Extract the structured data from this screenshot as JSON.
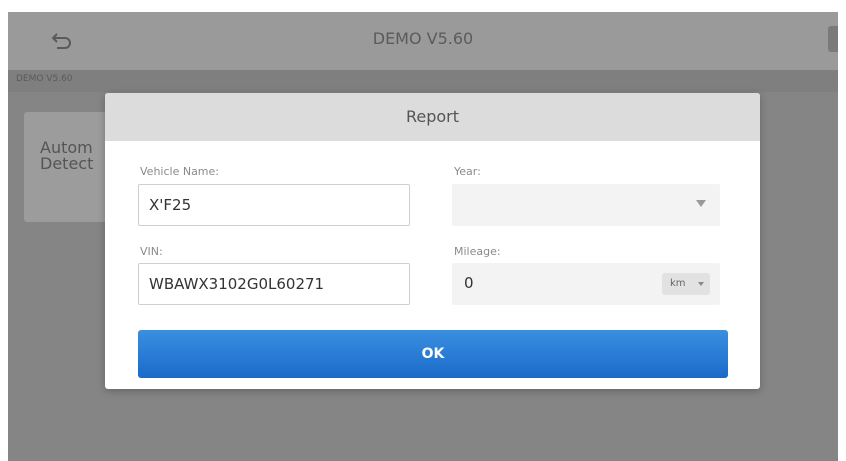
{
  "app": {
    "title": "DEMO V5.60",
    "breadcrumb": "DEMO V5.60"
  },
  "background": {
    "card_title": "Autom\nDetect"
  },
  "dialog": {
    "title": "Report",
    "vehicle_name_label": "Vehicle Name:",
    "vehicle_name_value": "X'F25",
    "year_label": "Year:",
    "year_value": "",
    "vin_label": "VIN:",
    "vin_value": "WBAWX3102G0L60271",
    "mileage_label": "Mileage:",
    "mileage_value": "0",
    "mileage_unit": "km",
    "ok_label": "OK"
  },
  "colors": {
    "ok_button": "#2a7fd8",
    "dialog_header": "#dcdcdc",
    "overlay": "#8a8a8a"
  },
  "icons": {
    "back": "back-arrow-icon",
    "dropdown": "chevron-down-icon"
  }
}
